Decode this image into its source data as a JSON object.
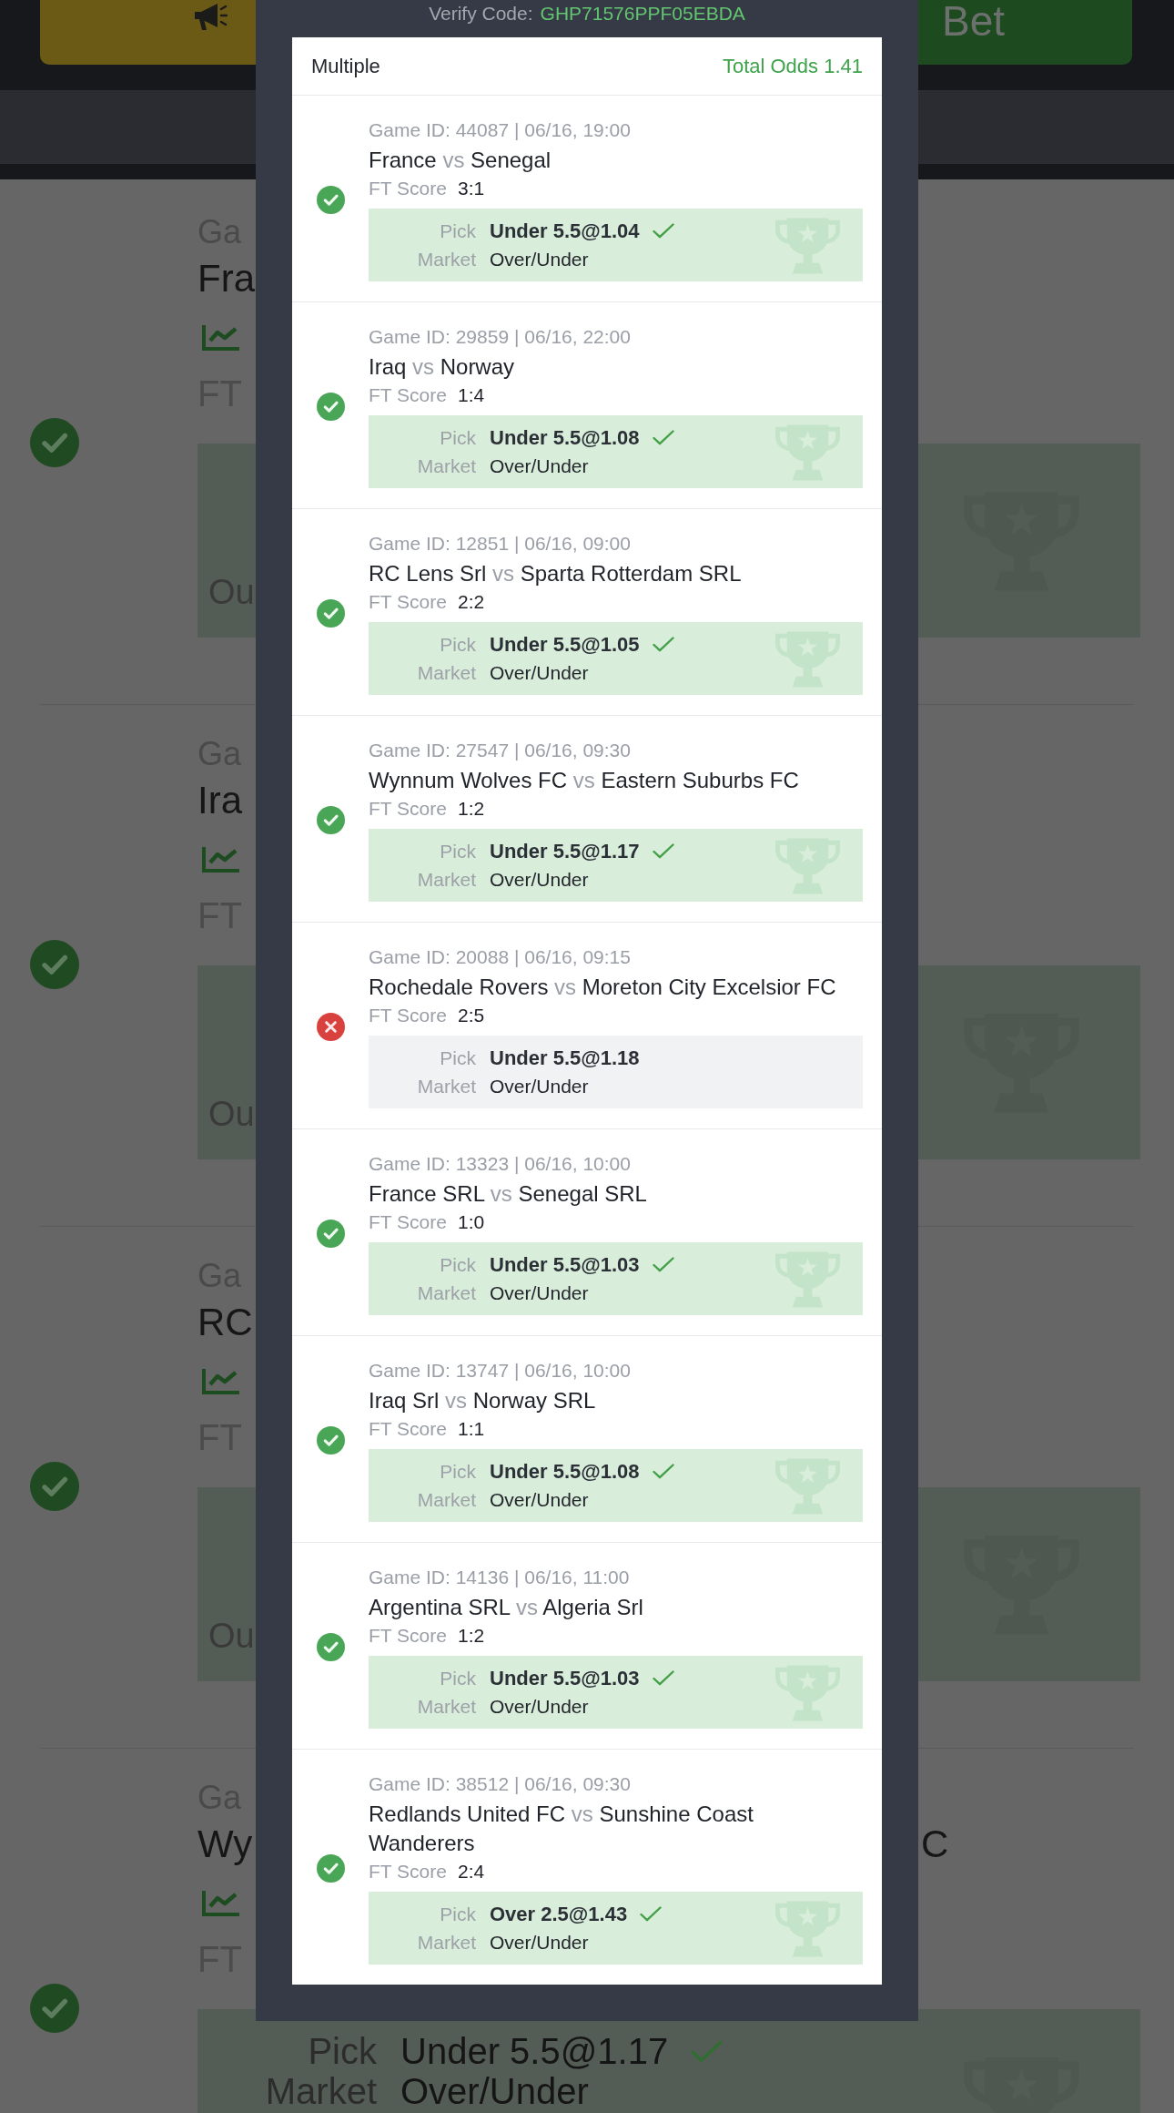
{
  "background": {
    "header": {
      "bet_button": "Bet"
    },
    "sections": [
      {
        "kind": "collapsed",
        "game": "Ga",
        "team": "Fra",
        "score_label": "FT",
        "market": "Ou"
      },
      {
        "kind": "collapsed",
        "game": "Ga",
        "team": "Ira",
        "score_label": "FT",
        "market": "Ou"
      },
      {
        "kind": "collapsed",
        "game": "Ga",
        "team": "RC",
        "score_label": "FT",
        "market": "Ou"
      },
      {
        "kind": "expanded",
        "game": "Ga",
        "team": "Wy",
        "team_end": "C",
        "score_label": "FT",
        "pick_label": "Pick",
        "pick": "Under 5.5@1.17",
        "market_label": "Market",
        "market": "Over/Under"
      }
    ]
  },
  "modal": {
    "verify_label": "Verify Code:",
    "verify_code": "GHP71576PPF05EBDA",
    "bet_type": "Multiple",
    "total_odds": "Total Odds 1.41",
    "bets": [
      {
        "kind": "won",
        "game": "Game ID: 44087 | 06/16, 19:00",
        "home": "France",
        "vs": "vs",
        "away": "Senegal",
        "score_label": "FT Score",
        "score": "3:1",
        "pick_label": "Pick",
        "pick": "Under 5.5@1.04",
        "market_label": "Market",
        "market": "Over/Under"
      },
      {
        "kind": "won",
        "game": "Game ID: 29859 | 06/16, 22:00",
        "home": "Iraq",
        "vs": "vs",
        "away": "Norway",
        "score_label": "FT Score",
        "score": "1:4",
        "pick_label": "Pick",
        "pick": "Under 5.5@1.08",
        "market_label": "Market",
        "market": "Over/Under"
      },
      {
        "kind": "won",
        "game": "Game ID: 12851 | 06/16, 09:00",
        "home": "RC Lens Srl",
        "vs": "vs",
        "away": "Sparta Rotterdam SRL",
        "score_label": "FT Score",
        "score": "2:2",
        "pick_label": "Pick",
        "pick": "Under 5.5@1.05",
        "market_label": "Market",
        "market": "Over/Under"
      },
      {
        "kind": "won",
        "game": "Game ID: 27547 | 06/16, 09:30",
        "home": "Wynnum Wolves FC",
        "vs": "vs",
        "away": "Eastern Suburbs FC",
        "score_label": "FT Score",
        "score": "1:2",
        "pick_label": "Pick",
        "pick": "Under 5.5@1.17",
        "market_label": "Market",
        "market": "Over/Under"
      },
      {
        "kind": "lost",
        "game": "Game ID: 20088 | 06/16, 09:15",
        "home": "Rochedale Rovers",
        "vs": "vs",
        "away": "Moreton City Excelsior FC",
        "score_label": "FT Score",
        "score": "2:5",
        "pick_label": "Pick",
        "pick": "Under 5.5@1.18",
        "market_label": "Market",
        "market": "Over/Under"
      },
      {
        "kind": "won",
        "game": "Game ID: 13323 | 06/16, 10:00",
        "home": "France SRL",
        "vs": "vs",
        "away": "Senegal SRL",
        "score_label": "FT Score",
        "score": "1:0",
        "pick_label": "Pick",
        "pick": "Under 5.5@1.03",
        "market_label": "Market",
        "market": "Over/Under"
      },
      {
        "kind": "won",
        "game": "Game ID: 13747 | 06/16, 10:00",
        "home": "Iraq Srl",
        "vs": "vs",
        "away": "Norway SRL",
        "score_label": "FT Score",
        "score": "1:1",
        "pick_label": "Pick",
        "pick": "Under 5.5@1.08",
        "market_label": "Market",
        "market": "Over/Under"
      },
      {
        "kind": "won",
        "game": "Game ID: 14136 | 06/16, 11:00",
        "home": "Argentina SRL",
        "vs": "vs",
        "away": "Algeria Srl",
        "score_label": "FT Score",
        "score": "1:2",
        "pick_label": "Pick",
        "pick": "Under 5.5@1.03",
        "market_label": "Market",
        "market": "Over/Under"
      },
      {
        "kind": "won",
        "game": "Game ID: 38512 | 06/16, 09:30",
        "home": "Redlands United FC",
        "vs": "vs",
        "away": "Sunshine Coast Wanderers",
        "score_label": "FT Score",
        "score": "2:4",
        "pick_label": "Pick",
        "pick": "Over 2.5@1.43",
        "market_label": "Market",
        "market": "Over/Under"
      }
    ]
  }
}
